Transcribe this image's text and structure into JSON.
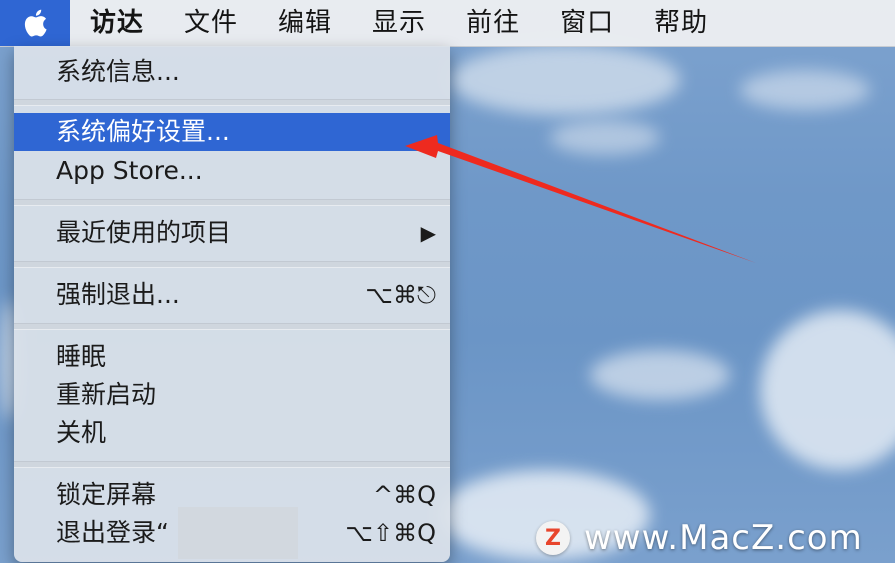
{
  "menubar": {
    "apple_icon": "apple-logo-icon",
    "items": [
      "访达",
      "文件",
      "编辑",
      "显示",
      "前往",
      "窗口",
      "帮助"
    ]
  },
  "apple_menu": {
    "items": {
      "about": "系统信息...",
      "prefs": "系统偏好设置...",
      "app_store": "App Store...",
      "recent": "最近使用的项目",
      "recent_arrow": "▶",
      "force_quit": "强制退出...",
      "force_quit_shortcut": "⌥⌘⎋",
      "sleep": "睡眠",
      "restart": "重新启动",
      "shutdown": "关机",
      "lock": "锁定屏幕",
      "lock_shortcut": "^⌘Q",
      "logout": "退出登录“",
      "logout_shortcut": "⌥⇧⌘Q"
    },
    "highlighted": "prefs"
  },
  "watermark": {
    "logo_letter": "Z",
    "text": "www.MacZ.com"
  },
  "colors": {
    "accent": "#2f66d3",
    "arrow": "#ee2a1f"
  }
}
